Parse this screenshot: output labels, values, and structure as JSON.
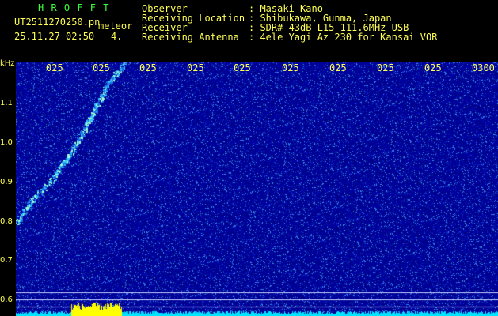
{
  "header": {
    "app_name": "H R O F F T",
    "filename": "UT2511270250.pn",
    "tag": "meteor",
    "datetime": "25.11.27 02:50",
    "index": "4.",
    "fields": [
      {
        "label": "Observer",
        "value": ": Masaki Kano"
      },
      {
        "label": "Receiving Location",
        "value": ": Shibukawa, Gunma, Japan"
      },
      {
        "label": "Receiver",
        "value": ": SDR# 43dB L15 111.6MHz USB"
      },
      {
        "label": "Receiving Antenna",
        "value": ": 4ele Yagi Az 230 for Kansai VOR"
      }
    ]
  },
  "axis": {
    "unit": "kHz",
    "y_ticks": [
      "1.1",
      "1.0",
      "0.9",
      "0.8",
      "0.7",
      "0.6"
    ],
    "x_ticks": [
      "025",
      "025",
      "025",
      "025",
      "025",
      "025",
      "025",
      "025",
      "025",
      "0300"
    ]
  },
  "colors": {
    "background": "#000000",
    "spectrum_base": "#00009a",
    "text_yellow": "#ffff55",
    "text_green": "#3cff3c",
    "trace_cyan": "#00e5ff",
    "burst_yellow": "#ffff00"
  }
}
